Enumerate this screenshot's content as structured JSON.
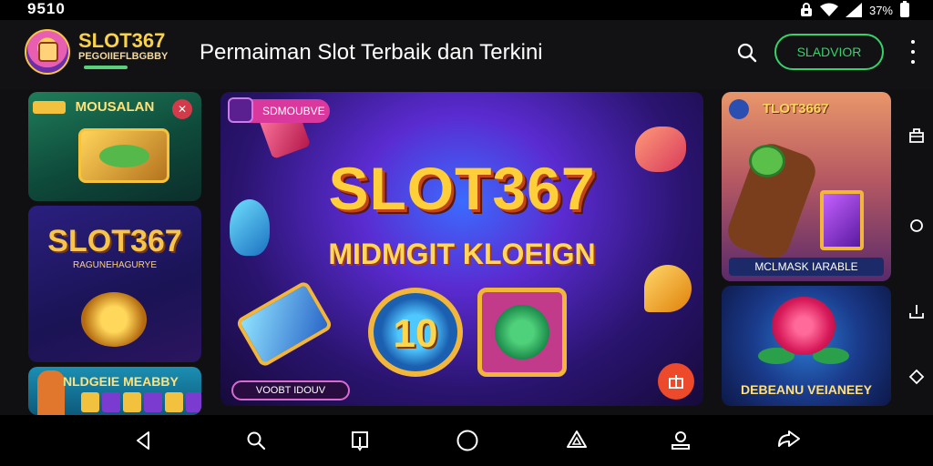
{
  "status_bar": {
    "time": "9510",
    "battery_text": "37%"
  },
  "header": {
    "logo_title": "SLOT367",
    "logo_subtitle": "PEGOIIEFLBGBBY",
    "page_title": "Permaiman Slot Terbaik dan Terkini",
    "cta_label": "SLADVIOR",
    "search_icon": "search-icon",
    "more_icon": "more-vertical-icon"
  },
  "cards": {
    "left_top": {
      "title": "MOUSALAN"
    },
    "left_middle": {
      "title": "SLOT367",
      "subtitle": "RAGUNEHAGURYE"
    },
    "left_bottom": {
      "title": "NLDGEIE MEABBY"
    },
    "hero": {
      "badge": "SDMOUBVE",
      "title": "SLOT367",
      "subtitle": "MIDMGIT KLOEIGN",
      "reel_text": "10",
      "button": "VOOBT IDOUV"
    },
    "right_top": {
      "title": "TLOT3667",
      "label": "MCLMASK IARABLE"
    },
    "right_bottom": {
      "title": "DEBEANU VEIANEEY"
    }
  },
  "right_rail": [
    "bag-icon",
    "circle-icon",
    "download-tray-icon",
    "diamond-icon"
  ],
  "bottom_nav": [
    "back-icon",
    "search-icon",
    "bookmark-icon",
    "home-circle-icon",
    "recycle-icon",
    "user-icon",
    "share-icon"
  ],
  "colors": {
    "accent_green": "#35d36a",
    "gold": "#ffcf3a",
    "background": "#0b0b0e"
  }
}
